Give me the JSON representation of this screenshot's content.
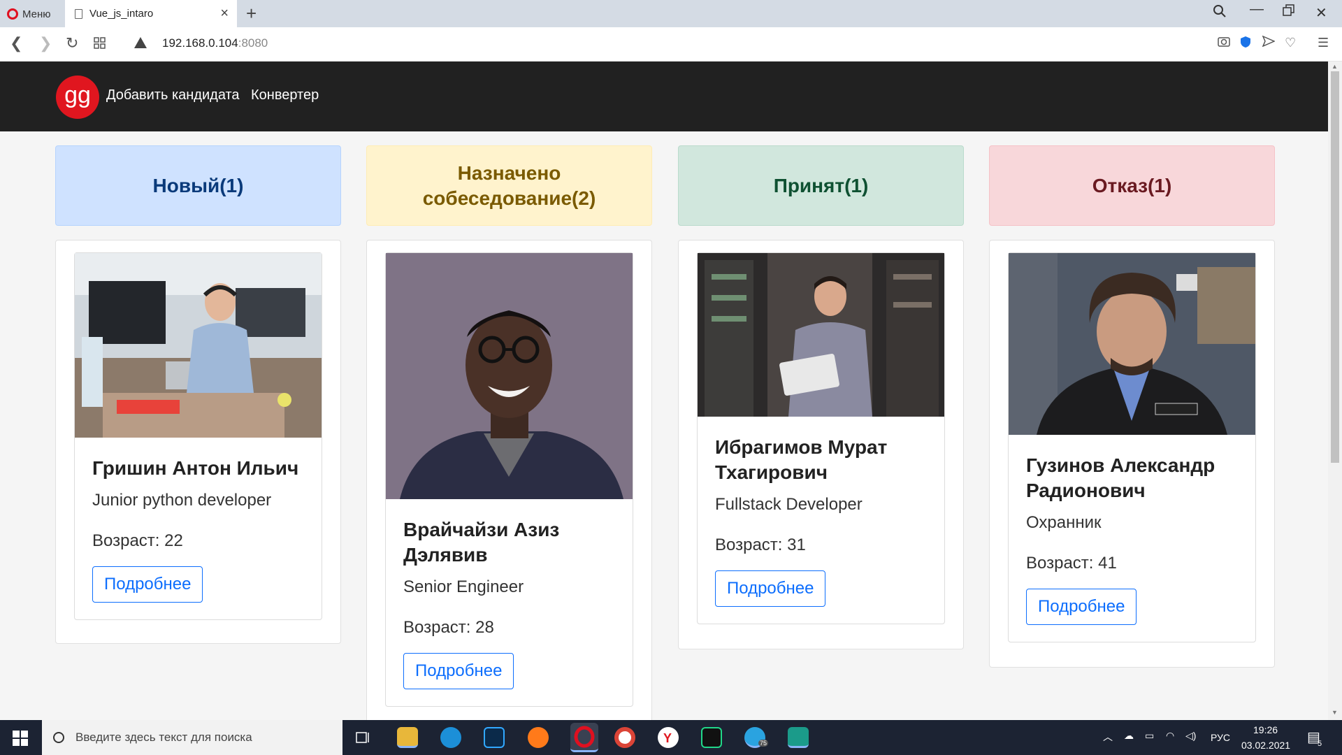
{
  "browser": {
    "menu_label": "Меню",
    "tab_title": "Vue_js_intaro",
    "url_host": "192.168.0.104",
    "url_port": ":8080"
  },
  "navbar": {
    "logo_text": "gg",
    "links": [
      "Добавить кандидата",
      "Конвертер"
    ]
  },
  "columns": [
    {
      "title": "Новый(1)",
      "bg": "#cfe2ff",
      "fg": "#0a3a7a",
      "border": "#b6d4fe",
      "candidate": {
        "name": "Гришин Антон Ильич",
        "position": "Junior python developer",
        "age_label": "Возраст: 22",
        "button": "Подробнее"
      }
    },
    {
      "title": "Назначено собеседование(2)",
      "bg": "#fff3cd",
      "fg": "#7a5a00",
      "border": "#ffecb5",
      "candidate": {
        "name": "Врайчайзи Азиз Дэлявив",
        "position": "Senior Engineer",
        "age_label": "Возраст: 28",
        "button": "Подробнее"
      }
    },
    {
      "title": "Принят(1)",
      "bg": "#d1e7dd",
      "fg": "#0f5132",
      "border": "#badbcc",
      "candidate": {
        "name": "Ибрагимов Мурат Тхагирович",
        "position": "Fullstack Developer",
        "age_label": "Возраст: 31",
        "button": "Подробнее"
      }
    },
    {
      "title": "Отказ(1)",
      "bg": "#f8d7da",
      "fg": "#6a1a21",
      "border": "#f5c2c7",
      "candidate": {
        "name": "Гузинов Александр Радионович",
        "position": "Охранник",
        "age_label": "Возраст: 41",
        "button": "Подробнее"
      }
    }
  ],
  "taskbar": {
    "search_placeholder": "Введите здесь текст для поиска",
    "lang": "РУС",
    "time": "19:26",
    "date": "03.02.2021",
    "notifications": "5",
    "telegram_badge": "75"
  }
}
